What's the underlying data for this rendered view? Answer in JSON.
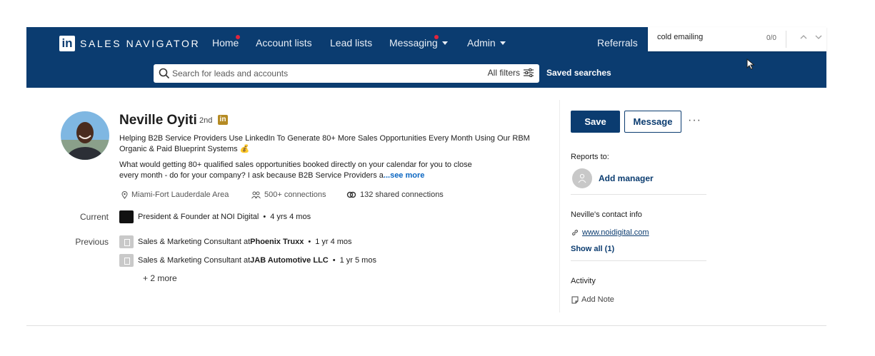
{
  "nav": {
    "brand": "SALES NAVIGATOR",
    "logo_letters": "in",
    "items": [
      {
        "label": "Home",
        "has_dot": true
      },
      {
        "label": "Account lists"
      },
      {
        "label": "Lead lists"
      },
      {
        "label": "Messaging",
        "has_dot": true,
        "dropdown": true
      },
      {
        "label": "Admin",
        "dropdown": true
      },
      {
        "label": "Referrals"
      }
    ],
    "search_placeholder": "Search for leads and accounts",
    "all_filters": "All filters",
    "saved_searches": "Saved searches"
  },
  "find_bar": {
    "value": "cold emailing",
    "count": "0/0",
    "up_icon": "chevron-up-icon",
    "down_icon": "chevron-down-icon"
  },
  "profile": {
    "name": "Neville Oyiti",
    "degree": "2nd",
    "badge": "in",
    "headline": "Helping B2B Service Providers Use LinkedIn To Generate 80+ More Sales Opportunities Every Month Using Our RBM Organic & Paid Blueprint Systems 💰",
    "about": "What would getting 80+ qualified sales opportunities booked directly on your calendar for you to close every month - do for your company? I ask because B2B Service Providers a",
    "see_more": "...see more",
    "location": "Miami-Fort Lauderdale Area",
    "connections": "500+ connections",
    "shared_connections": "132 shared connections"
  },
  "experience": {
    "current_label": "Current",
    "current": {
      "title": "President & Founder at NOI Digital",
      "duration": "4 yrs 4 mos"
    },
    "previous_label": "Previous",
    "previous": [
      {
        "title": "Sales & Marketing Consultant at ",
        "company": "Phoenix Truxx",
        "duration": "1 yr 4 mos"
      },
      {
        "title": "Sales & Marketing Consultant at ",
        "company": "JAB Automotive LLC",
        "duration": "1 yr 5 mos"
      }
    ],
    "more": "+ 2 more"
  },
  "actions": {
    "save": "Save",
    "message": "Message",
    "more": "···"
  },
  "sidebar": {
    "reports_to": "Reports to:",
    "add_manager": "Add manager",
    "contact_heading": "Neville's contact info",
    "website": "www.noidigital.com",
    "show_all": "Show all (1)",
    "activity": "Activity",
    "add_note": "Add Note"
  },
  "colors": {
    "navy": "#0b3c70",
    "link": "#0a66c2",
    "notification": "#e0243d"
  }
}
